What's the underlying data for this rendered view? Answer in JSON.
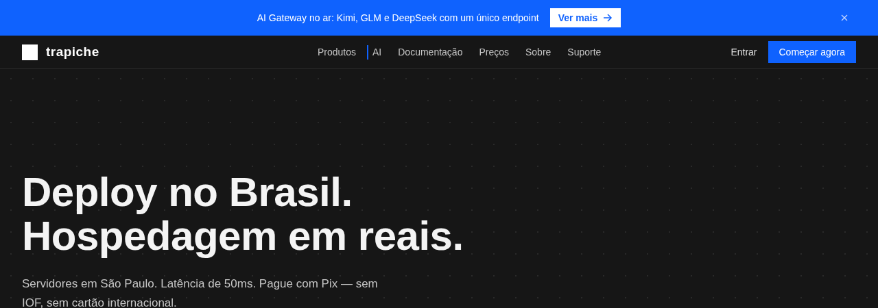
{
  "banner": {
    "text": "AI Gateway no ar: Kimi, GLM e DeepSeek com um único endpoint",
    "button": "Ver mais"
  },
  "nav": {
    "brand": "trapiche",
    "links": [
      {
        "label": "Produtos",
        "marked": false
      },
      {
        "label": "AI",
        "marked": true
      },
      {
        "label": "Documentação",
        "marked": false
      },
      {
        "label": "Preços",
        "marked": false
      },
      {
        "label": "Sobre",
        "marked": false
      },
      {
        "label": "Suporte",
        "marked": false
      }
    ],
    "login": "Entrar",
    "cta": "Começar agora"
  },
  "hero": {
    "headline": [
      "Deploy no Brasil.",
      "Hospedagem em reais."
    ],
    "lead": "Servidores em São Paulo. Latência de 50ms. Pague com Pix — sem IOF, sem cartão internacional."
  }
}
